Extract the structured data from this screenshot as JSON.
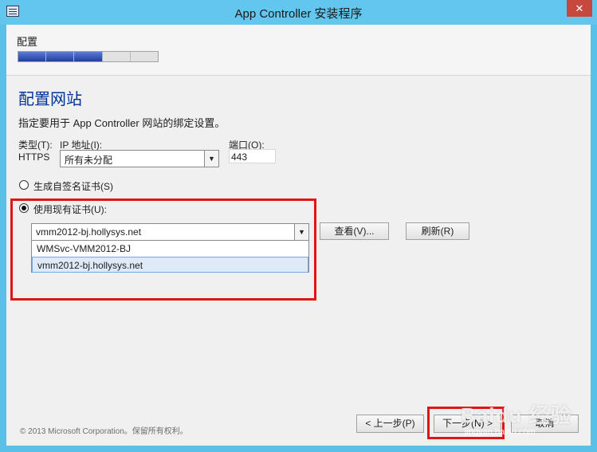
{
  "window": {
    "title": "App Controller 安装程序",
    "close_glyph": "✕"
  },
  "header": {
    "step_title": "配置",
    "progress_segments": 5,
    "progress_completed": 3
  },
  "main": {
    "heading": "配置网站",
    "description": "指定要用于 App Controller 网站的绑定设置。",
    "type_label": "类型(T):",
    "type_value": "HTTPS",
    "ip_label": "IP 地址(I):",
    "ip_value": "所有未分配",
    "port_label": "端口(O):",
    "port_value": "443",
    "radio_self_signed": "生成自签名证书(S)",
    "radio_existing": "使用现有证书(U):",
    "selected_radio": "existing",
    "cert_selected": "vmm2012-bj.hollysys.net",
    "cert_options": [
      "WMSvc-VMM2012-BJ",
      "vmm2012-bj.hollysys.net"
    ],
    "view_button": "查看(V)...",
    "refresh_button": "刷新(R)"
  },
  "footer": {
    "copyright": "© 2013 Microsoft Corporation。保留所有权利。",
    "back_button": "< 上一步(P)",
    "next_button": "下一步(N) >",
    "cancel_button": "取消"
  },
  "watermark": {
    "text": "Baidu 经验",
    "sub": "jingyan.baidu.com"
  },
  "colors": {
    "title_bar": "#62c6ee",
    "heading": "#003399",
    "highlight_frame": "#e01616",
    "progress_fill": "#213e9c"
  }
}
